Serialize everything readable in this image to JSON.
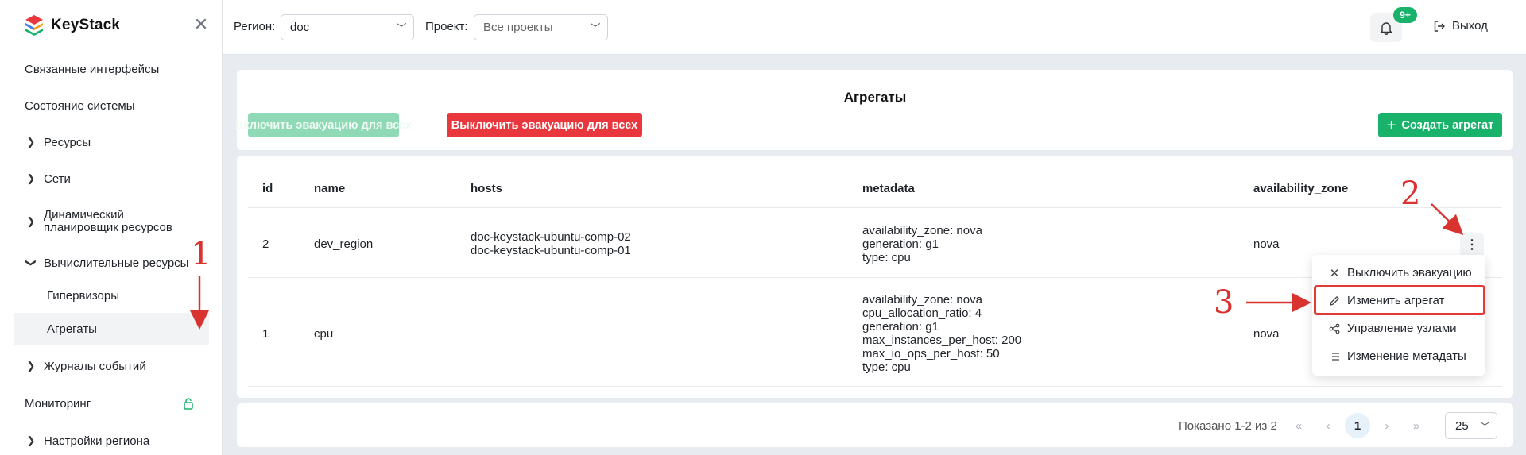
{
  "app": {
    "brand_name": "KeyStack",
    "colors": {
      "accent": "#18b26b",
      "danger": "#e8383d",
      "annotation": "#d9332f"
    }
  },
  "sidebar": {
    "items": [
      {
        "label": "Связанные интерфейсы"
      },
      {
        "label": "Состояние системы"
      },
      {
        "label": "Ресурсы",
        "expandable": true
      },
      {
        "label": "Сети",
        "expandable": true
      },
      {
        "label_line1": "Динамический",
        "label_line2": "планировщик ресурсов",
        "expandable": true
      },
      {
        "label": "Вычислительные ресурсы",
        "expanded": true
      },
      {
        "label": "Гипервизоры",
        "sub": true
      },
      {
        "label": "Агрегаты",
        "sub": true,
        "active": true
      },
      {
        "label": "Журналы событий",
        "expandable": true
      },
      {
        "label": "Мониторинг",
        "icon": "lock-icon"
      },
      {
        "label": "Настройки региона",
        "expandable": true
      }
    ]
  },
  "header": {
    "region_label": "Регион:",
    "region_value": "doc",
    "project_label": "Проект:",
    "project_value": "Все проекты",
    "notifications_badge": "9+",
    "logout_label": "Выход"
  },
  "page": {
    "title": "Агрегаты",
    "enable_evac_all": "Включить эвакуацию для всех",
    "disable_evac_all": "Выключить эвакуацию для всех",
    "create_label": "Создать агрегат"
  },
  "table": {
    "columns": [
      "id",
      "name",
      "hosts",
      "metadata",
      "availability_zone"
    ],
    "rows": [
      {
        "id": "2",
        "name": "dev_region",
        "hosts": [
          "doc-keystack-ubuntu-comp-02",
          "doc-keystack-ubuntu-comp-01"
        ],
        "metadata": [
          "availability_zone: nova",
          "generation: g1",
          "type: cpu"
        ],
        "availability_zone": "nova"
      },
      {
        "id": "1",
        "name": "cpu",
        "hosts": [],
        "metadata": [
          "availability_zone: nova",
          "cpu_allocation_ratio: 4",
          "generation: g1",
          "max_instances_per_host: 200",
          "max_io_ops_per_host: 50",
          "type: cpu"
        ],
        "availability_zone": "nova"
      }
    ]
  },
  "menu": {
    "items": [
      {
        "label": "Выключить эвакуацию",
        "icon": "close-icon"
      },
      {
        "label": "Изменить агрегат",
        "icon": "pencil-icon",
        "highlighted": true
      },
      {
        "label": "Управление узлами",
        "icon": "share-nodes-icon"
      },
      {
        "label": "Изменение метадаты",
        "icon": "list-icon"
      }
    ]
  },
  "pagination": {
    "shown_text": "Показано 1-2 из 2",
    "current_page": "1",
    "per_page": "25"
  },
  "annotations": [
    "1",
    "2",
    "3"
  ]
}
